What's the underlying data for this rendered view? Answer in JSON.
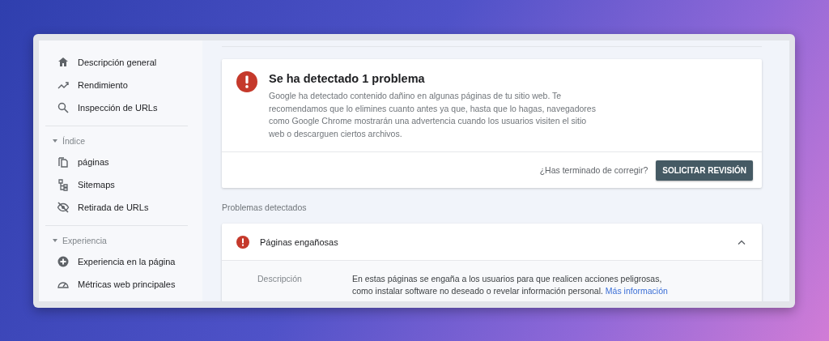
{
  "sidebar": {
    "sections": [
      {
        "items": [
          {
            "label": "Descripción general"
          },
          {
            "label": "Rendimiento"
          },
          {
            "label": "Inspección de URLs"
          }
        ]
      },
      {
        "title": "Índice",
        "expanded": true,
        "items": [
          {
            "label": "páginas"
          },
          {
            "label": "Sitemaps"
          },
          {
            "label": "Retirada de URLs"
          }
        ]
      },
      {
        "title": "Experiencia",
        "expanded": true,
        "items": [
          {
            "label": "Experiencia en la página"
          },
          {
            "label": "Métricas web principales"
          }
        ]
      }
    ]
  },
  "alert": {
    "title": "Se ha detectado 1 problema",
    "message": "Google ha detectado contenido dañino en algunas páginas de tu sitio web. Te recomendamos que lo elimines cuanto antes ya que, hasta que lo hagas, navegadores como Google Chrome mostrarán una advertencia cuando los usuarios visiten el sitio web o descarguen ciertos archivos.",
    "prompt": "¿Has terminado de corregir?",
    "button": "SOLICITAR REVISIÓN"
  },
  "issues": {
    "heading": "Problemas detectados",
    "items": [
      {
        "title": "Páginas engañosas",
        "expanded": true,
        "field_label": "Descripción",
        "description": "En estas páginas se engaña a los usuarios para que realicen acciones peligrosas, como instalar software no deseado o revelar información personal.",
        "link": "Más información"
      }
    ]
  }
}
